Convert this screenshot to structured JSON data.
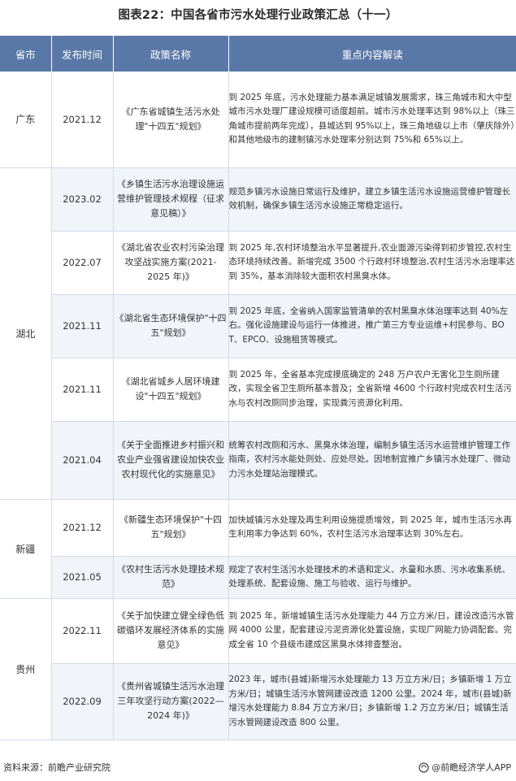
{
  "title": "图表22：中国各省市污水处理行业政策汇总（十一）",
  "headers": [
    "省市",
    "发布时间",
    "政策名称",
    "重点内容解读"
  ],
  "rows": [
    {
      "province": "广东",
      "date": "2021.12",
      "name": "《广东省城镇生活污水处理\"十四五\"规划》",
      "content": "到 2025 年底，污水处理能力基本满足城镇发展需求，珠三角城市和大中型城市污水处理厂建设规模可适度超前。城市污水处理率达到 98%以上（珠三角城市提前两年完成），县城达到 95%以上，珠三角地级以上市（肇庆除外）和其他地级市的建制镇污水处理率分别达到 75%和 65%以上。"
    },
    {
      "province": "湖北",
      "date": "2023.02",
      "name": "《乡镇生活污水治理设施运营维护管理技术规程（征求意见稿）》",
      "content": "规范乡镇污水设施日常运行及维护，建立乡镇生活污水设施运营维护管理长效机制，确保乡镇生活污水设施正常稳定运行。"
    },
    {
      "province": "",
      "date": "2022.07",
      "name": "《湖北省农业农村污染治理攻坚战实施方案(2021-2025 年)》",
      "content": "到 2025 年,农村环境整治水平显著提升,农业面源污染得到初步管控,农村生态环境持续改善。新增完成 3500 个行政村环境整治,农村生活污水治理率达到 35%，基本消除较大面积农村黑臭水体。"
    },
    {
      "province": "",
      "date": "2021.11",
      "name": "《湖北省生态环境保护\"十四五\"规划》",
      "content": "到 2025 年底，全省纳入国家监管清单的农村黑臭水体治理率达到 40%左右。强化设施建设与运行一体推进，推广第三方专业运维+村民参与、BOT、EPCO、设施租赁等模式。"
    },
    {
      "province": "",
      "date": "2021.11",
      "name": "《湖北省城乡人居环境建设\"十四五\"规划》",
      "content": "到 2025 年，全省基本完成摸底确定的 248 万户农户无害化卫生厕所建改，实现全省卫生厕所基本普及；全省新增 4600 个行政村完成农村生活污水与农村改厕同步治理，实现粪污资源化利用。"
    },
    {
      "province": "",
      "date": "2021.04",
      "name": "《关于全面推进乡村振兴和农业产业强省建设加快农业农村现代化的实施意见》",
      "content": "统筹农村改厕和污水、黑臭水体治理，编制乡镇生活污水运营维护管理工作指南，农村污水能处则处、应处尽处。因地制宜推广乡镇污水处理厂、微动力污水处理站治理模式。"
    },
    {
      "province": "新疆",
      "date": "2021.12",
      "name": "《新疆生态环境保护\"十四五\"规划》",
      "content": "加快城镇污水处理及再生利用设施提质增效，到 2025 年，城市生活污水再生利用率力争达到 60%，农村生活污水治理率达到 30%左右。"
    },
    {
      "province": "",
      "date": "2021.05",
      "name": "《农村生活污水处理技术规范》",
      "content": "规定了农村生活污水处理技术的术语和定义、水量和水质、污水收集系统、处理系统、配套设施、施工与验收、运行与维护。"
    },
    {
      "province": "贵州",
      "date": "2022.11",
      "name": "《关于加快建立健全绿色低碳循环发展经济体系的实施意见》",
      "content": "到 2025 年，新增城镇生活污水处理能力 44 万立方米/日，建设改造污水管网 4000 公里，配套建设污泥资源化处置设施，实现厂网能力协调配套。完成全省 10 个县级市建成区黑臭水体排查整治。"
    },
    {
      "province": "",
      "date": "2022.09",
      "name": "《贵州省城镇生活污水治理三年攻坚行动方案(2022—2024 年)》",
      "content": "2023 年，城市(县城)新增污水处理能力 13 万立方米/日；乡镇新增 1 万立方米/日；城镇生活污水管网建设改造 1200 公里。2024 年，城市(县城)新增污水处理能力 8.84 万立方米/日；乡镇新增 1.2 万立方米/日；城镇生活污水管网建设改造 800 公里。"
    }
  ],
  "footer": {
    "source": "资料来源：前瞻产业研究院",
    "app": "@前瞻经济学人APP"
  },
  "colors": {
    "header_bg": "#5a78a7",
    "alt_row_bg": "#f1f4f9",
    "border": "#d3dbe7"
  }
}
